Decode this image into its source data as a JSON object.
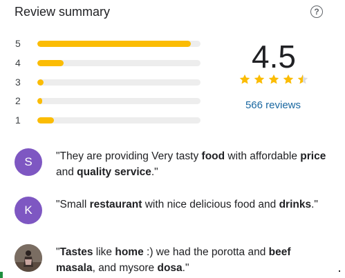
{
  "header": {
    "title": "Review summary",
    "help_icon": "help-circle-icon"
  },
  "histogram": [
    {
      "star": "5",
      "fraction": 0.94
    },
    {
      "star": "4",
      "fraction": 0.16
    },
    {
      "star": "3",
      "fraction": 0.04
    },
    {
      "star": "2",
      "fraction": 0.03
    },
    {
      "star": "1",
      "fraction": 0.1
    }
  ],
  "rating": {
    "value": "4.5",
    "stars": 4.5,
    "reviews_label": "566 reviews",
    "star_color": "#fbbc04"
  },
  "snippets": [
    {
      "avatar_letter": "S",
      "avatar_color": "#7e57c2",
      "segments": [
        {
          "text": "\"They are providing Very tasty ",
          "bold": false
        },
        {
          "text": "food",
          "bold": true
        },
        {
          "text": " with affordable ",
          "bold": false
        },
        {
          "text": "price",
          "bold": true
        },
        {
          "text": " and ",
          "bold": false
        },
        {
          "text": "quality service",
          "bold": true
        },
        {
          "text": ".\"",
          "bold": false
        }
      ]
    },
    {
      "avatar_letter": "K",
      "avatar_color": "#7e57c2",
      "segments": [
        {
          "text": "\"Small ",
          "bold": false
        },
        {
          "text": "restaurant",
          "bold": true
        },
        {
          "text": " with nice delicious food and ",
          "bold": false
        },
        {
          "text": "drinks",
          "bold": true
        },
        {
          "text": ".\"",
          "bold": false
        }
      ]
    },
    {
      "avatar_letter": "",
      "avatar_color": "#6b5a4c",
      "segments": [
        {
          "text": "\"",
          "bold": false
        },
        {
          "text": "Tastes",
          "bold": true
        },
        {
          "text": " like ",
          "bold": false
        },
        {
          "text": "home",
          "bold": true
        },
        {
          "text": " :) we had the porotta and ",
          "bold": false
        },
        {
          "text": "beef masala",
          "bold": true
        },
        {
          "text": ", and mysore ",
          "bold": false
        },
        {
          "text": "dosa",
          "bold": true
        },
        {
          "text": ".\"",
          "bold": false
        }
      ]
    }
  ]
}
